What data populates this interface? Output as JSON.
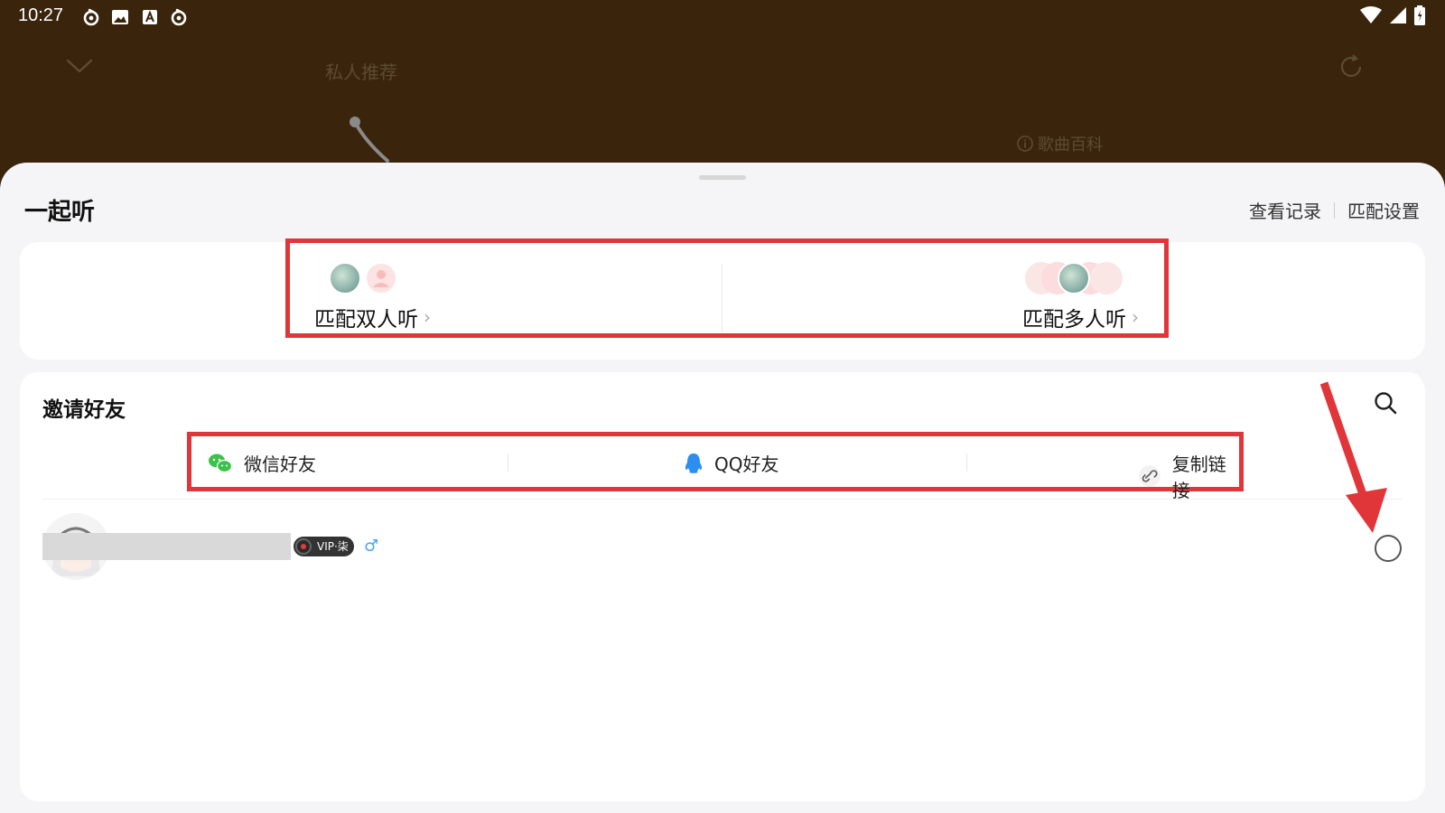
{
  "status_bar": {
    "time": "10:27",
    "left_icons": [
      "netease-music-icon",
      "gallery-icon",
      "font-icon",
      "netease-music-icon"
    ],
    "right_icons": [
      "wifi-icon",
      "signal-icon",
      "battery-icon"
    ]
  },
  "player": {
    "title": "私人推荐",
    "song_wiki": "歌曲百科"
  },
  "sheet": {
    "title": "一起听",
    "actions": {
      "history": "查看记录",
      "match_settings": "匹配设置"
    }
  },
  "match": {
    "pair_label": "匹配双人听",
    "multi_label": "匹配多人听"
  },
  "invite": {
    "title": "邀请好友",
    "share": {
      "wechat": "微信好友",
      "qq": "QQ好友",
      "copy_link": "复制链接"
    },
    "friends": [
      {
        "vip_badge": "VIP·柒",
        "gender": "♂"
      }
    ]
  },
  "colors": {
    "highlight_red": "#e0363a",
    "wechat_green": "#3cc24a",
    "qq_blue": "#2b8ef0",
    "player_bg": "#3a240c"
  }
}
